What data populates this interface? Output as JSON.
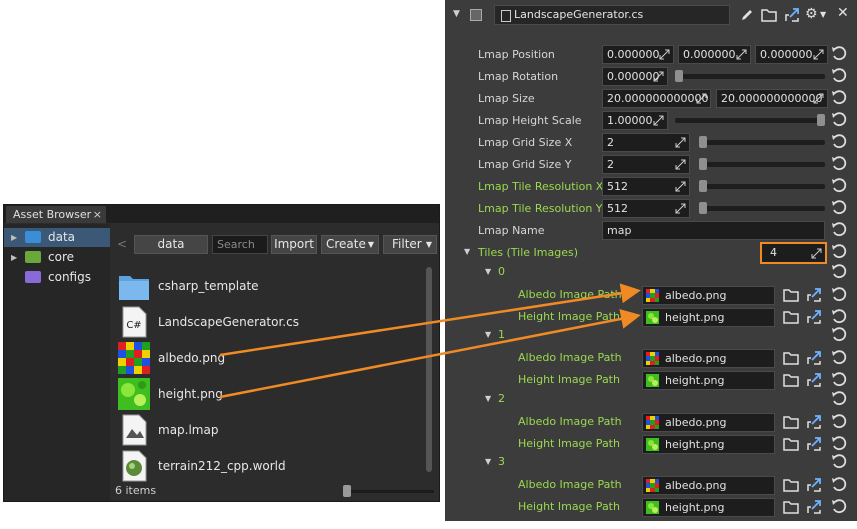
{
  "asset_browser": {
    "tab_title": "Asset Browser",
    "tab_close": "×",
    "tree": [
      {
        "label": "data",
        "selected": true,
        "color": "#3a8ed8"
      },
      {
        "label": "core",
        "selected": false,
        "color": "#6aa83a"
      },
      {
        "label": "configs",
        "selected": false,
        "color": "#8a6ad8"
      }
    ],
    "toolbar": {
      "back": "<",
      "path": "data",
      "search_placeholder": "Search",
      "import": "Import",
      "create": "Create",
      "filter": "Filter"
    },
    "files": [
      {
        "name": "csharp_template",
        "icon": "folder-icon"
      },
      {
        "name": "LandscapeGenerator.cs",
        "icon": "csharp-file-icon",
        "badge": "C#"
      },
      {
        "name": "albedo.png",
        "icon": "albedo-image-icon"
      },
      {
        "name": "height.png",
        "icon": "height-image-icon"
      },
      {
        "name": "map.lmap",
        "icon": "lmap-file-icon"
      },
      {
        "name": "terrain212_cpp.world",
        "icon": "world-file-icon"
      }
    ],
    "status": "6 items"
  },
  "inspector": {
    "component_name": "LandscapeGenerator.cs",
    "props": {
      "lmap_position": {
        "label": "Lmap Position",
        "x": "0.000000",
        "y": "0.000000",
        "z": "0.000000"
      },
      "lmap_rotation": {
        "label": "Lmap Rotation",
        "value": "0.000000"
      },
      "lmap_size": {
        "label": "Lmap Size",
        "x": "20.000000000000",
        "y": "20.000000000000"
      },
      "lmap_height_scale": {
        "label": "Lmap Height Scale",
        "value": "1.00000"
      },
      "lmap_grid_x": {
        "label": "Lmap Grid Size X",
        "value": "2"
      },
      "lmap_grid_y": {
        "label": "Lmap Grid Size Y",
        "value": "2"
      },
      "lmap_tile_res_x": {
        "label": "Lmap Tile Resolution X",
        "value": "512"
      },
      "lmap_tile_res_y": {
        "label": "Lmap Tile Resolution Y",
        "value": "512"
      },
      "lmap_name": {
        "label": "Lmap Name",
        "value": "map"
      }
    },
    "tiles": {
      "label": "Tiles (Tile Images)",
      "count": "4"
    },
    "tile_items": [
      {
        "index": "0",
        "albedo_label": "Albedo Image Path",
        "albedo_value": "albedo.png",
        "height_label": "Height Image Path",
        "height_value": "height.png"
      },
      {
        "index": "1",
        "albedo_label": "Albedo Image Path",
        "albedo_value": "albedo.png",
        "height_label": "Height Image Path",
        "height_value": "height.png"
      },
      {
        "index": "2",
        "albedo_label": "Albedo Image Path",
        "albedo_value": "albedo.png",
        "height_label": "Height Image Path",
        "height_value": "height.png"
      },
      {
        "index": "3",
        "albedo_label": "Albedo Image Path",
        "albedo_value": "albedo.png",
        "height_label": "Height Image Path",
        "height_value": "height.png"
      }
    ],
    "slider_levels": {
      "rotation": 0.0,
      "height_scale": 1.0,
      "grid_x": 0.0,
      "grid_y": 0.0,
      "tile_res_x": 0.0,
      "tile_res_y": 0.0
    }
  },
  "colors": {
    "label_green": "#9ad94f",
    "highlight_orange": "#f08a24",
    "selection_blue": "#3b5877"
  }
}
